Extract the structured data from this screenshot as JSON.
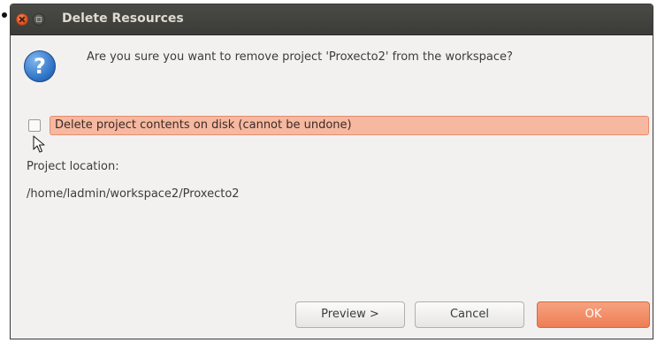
{
  "window": {
    "title": "Delete Resources",
    "close_icon": "close-icon",
    "maximize_icon": "maximize-icon"
  },
  "dialog": {
    "icon": "question-icon",
    "icon_glyph": "?",
    "question": "Are you sure you want to remove project 'Proxecto2' from the workspace?",
    "delete_contents": {
      "label": "Delete project contents on disk (cannot be undone)",
      "checked": false,
      "highlight_color": "#f6b8a0"
    },
    "location_label": "Project location:",
    "location_value": "/home/ladmin/workspace2/Proxecto2"
  },
  "buttons": {
    "preview": "Preview >",
    "cancel": "Cancel",
    "ok": "OK"
  },
  "colors": {
    "titlebar": "#3c3b37",
    "title_text": "#dfdbd2",
    "accent_ok": "#f08a63",
    "dialog_bg": "#f2f1f0"
  }
}
